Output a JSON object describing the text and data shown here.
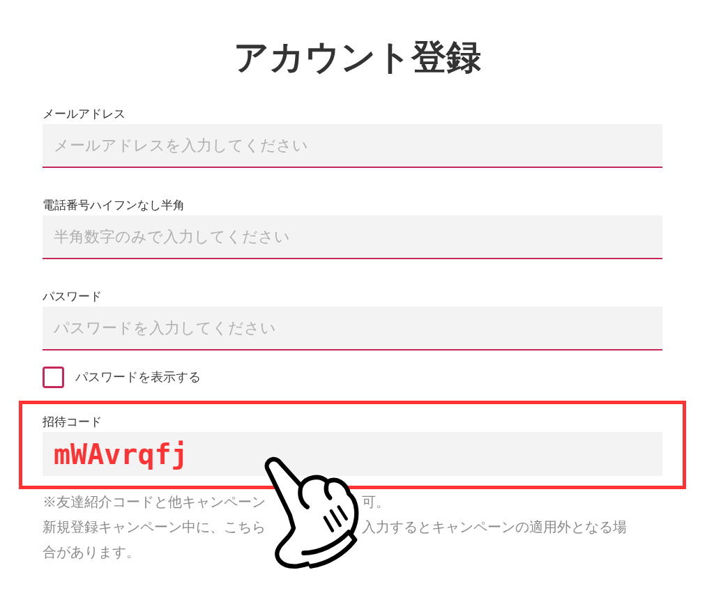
{
  "title": "アカウント登録",
  "fields": [
    {
      "label": "メールアドレス",
      "placeholder": "メールアドレスを入力してください",
      "highlighted": false
    },
    {
      "label": "電話番号ハイフンなし半角",
      "placeholder": "半角数字のみで入力してください",
      "highlighted": false
    },
    {
      "label": "パスワード",
      "placeholder": "パスワードを入力してください",
      "highlighted": false
    }
  ],
  "show_password": {
    "label": "パスワードを表示する",
    "checked": false
  },
  "invite": {
    "label": "招待コード",
    "value": "mWAvrqfj",
    "highlighted": true
  },
  "note": {
    "lines": [
      [
        {
          "text": "※友達紹介コードと他キャンペーン"
        },
        {
          "text": "可。"
        }
      ],
      [
        {
          "text": "新規登録キャンペーン中に、こちら"
        },
        {
          "text": "入力するとキャンペーンの適用外となる場"
        }
      ],
      [
        {
          "text": "合があります。"
        }
      ]
    ]
  }
}
